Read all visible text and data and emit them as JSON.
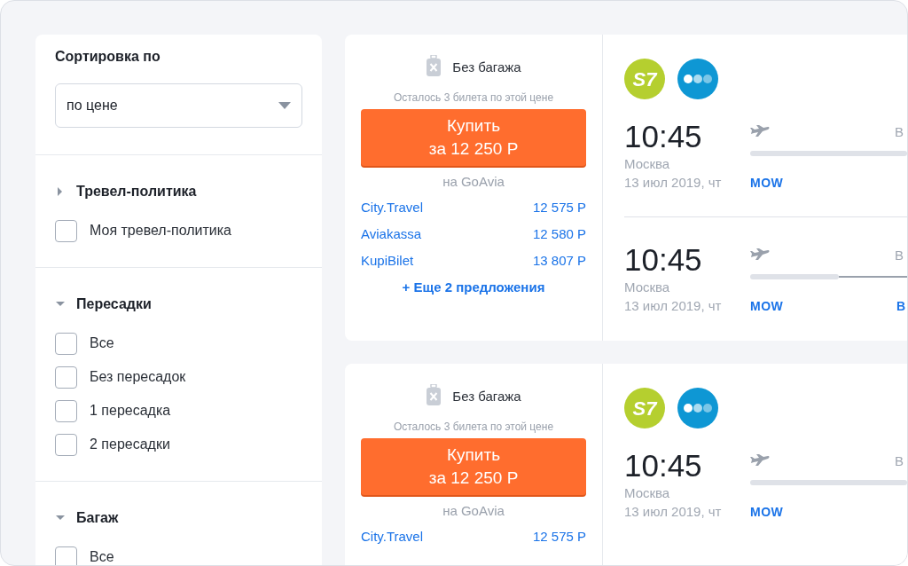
{
  "sort": {
    "title": "Сортировка по",
    "value": "по цене"
  },
  "filters": [
    {
      "title": "Тревел-политика",
      "expanded": false,
      "options": [
        {
          "label": "Моя тревел-политика",
          "checked": false
        }
      ]
    },
    {
      "title": "Пересадки",
      "expanded": true,
      "options": [
        {
          "label": "Все",
          "checked": false
        },
        {
          "label": "Без пересадок",
          "checked": false
        },
        {
          "label": "1 пересадка",
          "checked": false
        },
        {
          "label": "2 пересадки",
          "checked": false
        }
      ]
    },
    {
      "title": "Багаж",
      "expanded": true,
      "options": [
        {
          "label": "Все",
          "checked": false
        }
      ]
    }
  ],
  "tickets": [
    {
      "baggage": "Без багажа",
      "remaining": "Осталось 3 билета по этой цене",
      "buy_label": "Купить",
      "buy_price": "за 12 250 Р",
      "agency": "на GoAvia",
      "offers": [
        {
          "name": "City.Travel",
          "price": "12 575 Р"
        },
        {
          "name": "Aviakassa",
          "price": "12 580 Р"
        },
        {
          "name": "KupiBilet",
          "price": "13 807 Р"
        }
      ],
      "more": "+ Еще 2 предложения",
      "airlines": [
        {
          "kind": "letters",
          "text": "S7",
          "color": "#b5cf2f"
        },
        {
          "kind": "dots",
          "color": "#0e97d4"
        }
      ],
      "segments": [
        {
          "time": "10:45",
          "city": "Москва",
          "date": "13 июл 2019, чт",
          "code": "MOW",
          "duration": "В",
          "layover": false
        },
        {
          "time": "10:45",
          "city": "Москва",
          "date": "13 июл 2019, чт",
          "code": "MOW",
          "duration": "В",
          "layover": true,
          "arrival_code": "В"
        }
      ]
    },
    {
      "baggage": "Без багажа",
      "remaining": "Осталось 3 билета по этой цене",
      "buy_label": "Купить",
      "buy_price": "за 12 250 Р",
      "agency": "на GoAvia",
      "offers": [
        {
          "name": "City.Travel",
          "price": "12 575 Р"
        }
      ],
      "airlines": [
        {
          "kind": "letters",
          "text": "S7",
          "color": "#b5cf2f"
        },
        {
          "kind": "dots",
          "color": "#0e97d4"
        }
      ],
      "segments": [
        {
          "time": "10:45",
          "city": "Москва",
          "date": "13 июл 2019, чт",
          "code": "MOW",
          "duration": "В",
          "layover": false
        }
      ]
    }
  ]
}
